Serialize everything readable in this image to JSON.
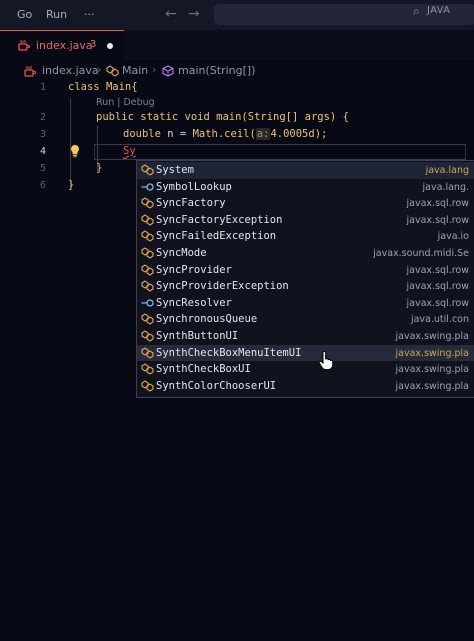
{
  "menu": {
    "go": "Go",
    "run": "Run",
    "more": "···"
  },
  "nav": {
    "back": "←",
    "forward": "→"
  },
  "command_center": {
    "text": "JAVA"
  },
  "tab": {
    "label": "index.java",
    "badge": "3"
  },
  "breadcrumb": {
    "file": "index.java",
    "class": "Main",
    "method": "main(String[])"
  },
  "codelens": "Run | Debug",
  "line_numbers": [
    "1",
    "2",
    "3",
    "4",
    "5",
    "6"
  ],
  "code": {
    "l1_kw": "class",
    "l1_name": "Main{",
    "l2_kw": "public static void",
    "l2_fn": "main",
    "l2_args": "(String[] args) {",
    "l3_type": "double",
    "l3_var": "n",
    "l3_eq": "=",
    "l3_call": "Math.ceil(",
    "l3_hint": "a:",
    "l3_val": "4.0005d",
    "l3_end": ");",
    "l4_text": "Sy",
    "l5_text": "}",
    "l6_text": "}"
  },
  "suggestions": [
    {
      "label": "System",
      "detail": "java.lang",
      "icon": "class-icon"
    },
    {
      "label": "SymbolLookup",
      "detail": "java.lang.",
      "icon": "interface-icon"
    },
    {
      "label": "SyncFactory",
      "detail": "javax.sql.row",
      "icon": "class-icon"
    },
    {
      "label": "SyncFactoryException",
      "detail": "javax.sql.row",
      "icon": "class-icon"
    },
    {
      "label": "SyncFailedException",
      "detail": "java.io",
      "icon": "class-icon"
    },
    {
      "label": "SyncMode",
      "detail": "javax.sound.midi.Se",
      "icon": "class-icon"
    },
    {
      "label": "SyncProvider",
      "detail": "javax.sql.row",
      "icon": "class-icon"
    },
    {
      "label": "SyncProviderException",
      "detail": "javax.sql.row",
      "icon": "class-icon"
    },
    {
      "label": "SyncResolver",
      "detail": "javax.sql.row",
      "icon": "interface-icon"
    },
    {
      "label": "SynchronousQueue",
      "detail": "java.util.con",
      "icon": "class-icon"
    },
    {
      "label": "SynthButtonUI",
      "detail": "javax.swing.pla",
      "icon": "class-icon"
    },
    {
      "label": "SynthCheckBoxMenuItemUI",
      "detail": "javax.swing.pla",
      "icon": "class-icon"
    },
    {
      "label": "SynthCheckBoxUI",
      "detail": "javax.swing.pla",
      "icon": "class-icon"
    },
    {
      "label": "SynthColorChooserUI",
      "detail": "javax.swing.pla",
      "icon": "class-icon"
    }
  ],
  "colors": {
    "accent": "#e8544b",
    "keyword": "#e5c36b",
    "match": "#ffffff",
    "icon": "#e8a94a"
  }
}
